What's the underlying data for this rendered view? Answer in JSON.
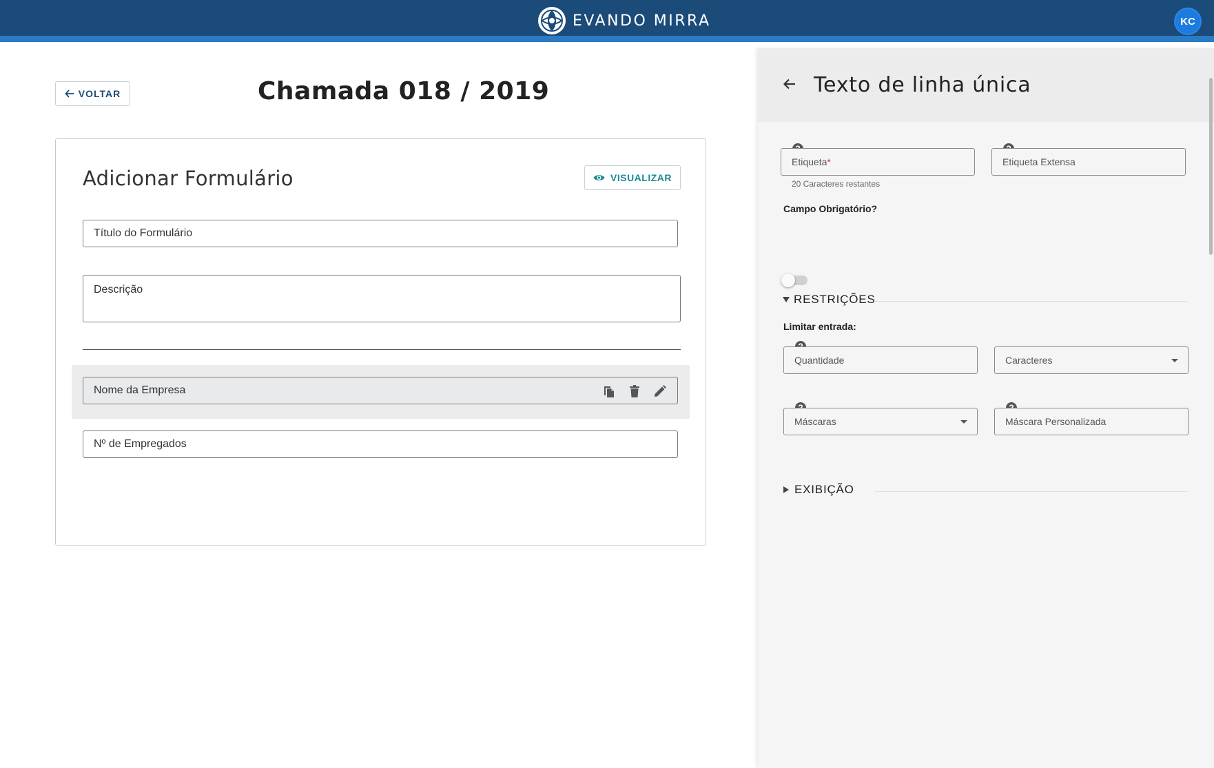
{
  "header": {
    "brand_name": "EVANDO MIRRA",
    "user_initials": "KC",
    "brand_color": "#1b4b78",
    "accent_color": "#2a7bc4"
  },
  "main": {
    "back_label": "VOLTAR",
    "page_title": "Chamada 018 / 2019",
    "card_title": "Adicionar Formulário",
    "preview_label": "VISUALIZAR",
    "form_title_placeholder": "Título do Formulário",
    "description_placeholder": "Descrição",
    "fields": [
      {
        "label": "Nome da Empresa",
        "selected": true
      },
      {
        "label": "Nº de Empregados",
        "selected": false
      }
    ],
    "icons": {
      "copy": "copy-icon",
      "delete": "trash-icon",
      "edit": "pencil-icon",
      "preview": "eye-icon",
      "back": "arrow-left-icon"
    }
  },
  "panel": {
    "title": "Texto de linha única",
    "label_field": "Etiqueta",
    "required_mark": "*",
    "label_hint": "20 Caracteres restantes",
    "long_label_field": "Etiqueta Extensa",
    "required_question": "Campo Obrigatório?",
    "required_toggle_on": false,
    "restrictions_section": "RESTRIÇÕES",
    "limit_input_label": "Limitar entrada:",
    "quantity_field": "Quantidade",
    "characters_select": "Caracteres",
    "masks_select": "Máscaras",
    "custom_mask_field": "Máscara Personalizada",
    "display_section": "EXIBIÇÃO",
    "help_symbol": "?"
  }
}
